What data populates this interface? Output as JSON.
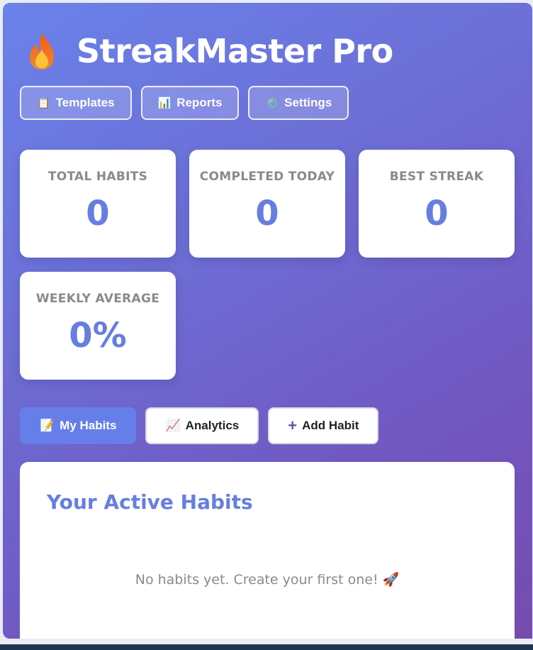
{
  "app": {
    "title": "StreakMaster Pro",
    "logo_icon": "flame-icon"
  },
  "toolbar": [
    {
      "label": "Templates",
      "icon": "clipboard-icon",
      "glyph": "📋"
    },
    {
      "label": "Reports",
      "icon": "bar-chart-icon",
      "glyph": "📊"
    },
    {
      "label": "Settings",
      "icon": "gear-icon",
      "glyph": "⚙️"
    }
  ],
  "stats": [
    {
      "label": "TOTAL HABITS",
      "value": "0"
    },
    {
      "label": "COMPLETED TODAY",
      "value": "0"
    },
    {
      "label": "BEST STREAK",
      "value": "0"
    },
    {
      "label": "WEEKLY AVERAGE",
      "value": "0%"
    }
  ],
  "tabs": [
    {
      "label": "My Habits",
      "icon": "memo-icon",
      "glyph": "📝",
      "active": true
    },
    {
      "label": "Analytics",
      "icon": "line-chart-icon",
      "glyph": "📈",
      "active": false
    },
    {
      "label": "Add Habit",
      "icon": "plus-icon",
      "glyph": "+",
      "active": false
    }
  ],
  "panel": {
    "title": "Your Active Habits",
    "empty_message": "No habits yet. Create your first one! 🚀"
  },
  "colors": {
    "accent": "#667eea",
    "gradient_start": "#6a82ea",
    "gradient_end": "#744cae"
  }
}
